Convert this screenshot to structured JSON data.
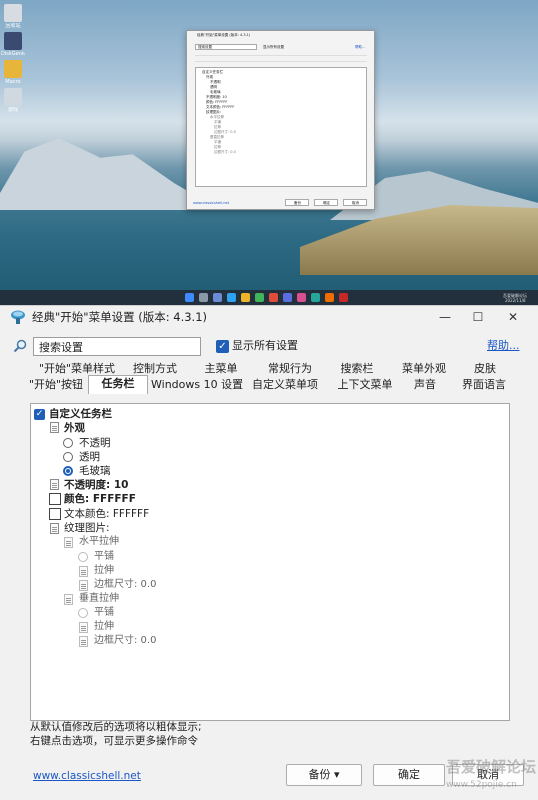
{
  "desktop": {
    "icons": [
      {
        "label": "回收站",
        "color": "#d7dce2"
      },
      {
        "label": "DiskGenius",
        "color": "#3a4a70"
      },
      {
        "label": "Macro",
        "color": "#e8b53b"
      },
      {
        "label": "游戏",
        "color": "#d0d8e0"
      }
    ],
    "taskbar_time": "2022/11/8",
    "taskbar_brand": "吾爱破解论坛"
  },
  "mini_window": {
    "title": "经典\"开始\"菜单设置 (版本: 4.3.1)",
    "search_placeholder": "搜索设置",
    "show_all": "显示所有设置",
    "help": "帮助...",
    "tree_lines": [
      "自定义任务栏",
      "外观",
      "不透明",
      "透明",
      "毛玻璃",
      "不透明度: 10",
      "颜色: FFFFFF",
      "文本颜色: FFFFFF",
      "纹理图片:",
      "水平拉伸",
      "平铺",
      "拉伸",
      "边框尺寸: 0.0",
      "垂直拉伸",
      "平铺",
      "拉伸",
      "边框尺寸: 0.0"
    ],
    "footer_link": "www.classicshell.net",
    "backup": "备份",
    "ok": "确定",
    "cancel": "取消"
  },
  "window": {
    "title": "经典\"开始\"菜单设置 (版本: 4.3.1)",
    "minimize": "—",
    "maximize": "☐",
    "close": "✕",
    "search_value": "搜索设置",
    "show_all_label": "显示所有设置",
    "help_link": "帮助...",
    "tabs_row1": [
      "\"开始\"菜单样式",
      "控制方式",
      "主菜单",
      "常规行为",
      "搜索栏",
      "菜单外观",
      "皮肤"
    ],
    "tabs_row2": [
      "\"开始\"按钮",
      "任务栏",
      "Windows 10 设置",
      "自定义菜单项",
      "上下文菜单",
      "声音",
      "界面语言"
    ],
    "active_tab": "任务栏",
    "tree": {
      "customize_taskbar": "自定义任务栏",
      "appearance": "外观",
      "opaque": "不透明",
      "transparent": "透明",
      "glass": "毛玻璃",
      "opacity": "不透明度: 10",
      "color": "颜色: FFFFFF",
      "text_color": "文本颜色: FFFFFF",
      "texture": "纹理图片:",
      "h_stretch": "水平拉伸",
      "h_tile": "平铺",
      "h_stretch_opt": "拉伸",
      "h_border": "边框尺寸: 0.0",
      "v_stretch": "垂直拉伸",
      "v_tile": "平铺",
      "v_stretch_opt": "拉伸",
      "v_border": "边框尺寸: 0.0"
    },
    "hint_line1": "从默认值修改后的选项将以粗体显示;",
    "hint_line2": "右键点击选项，可显示更多操作命令",
    "site_link": "www.classicshell.net",
    "backup_button": "备份 ▾",
    "ok_button": "确定",
    "cancel_button": "取消",
    "watermark": "吾爱破解论坛",
    "watermark_url": "www.52pojie.cn"
  }
}
